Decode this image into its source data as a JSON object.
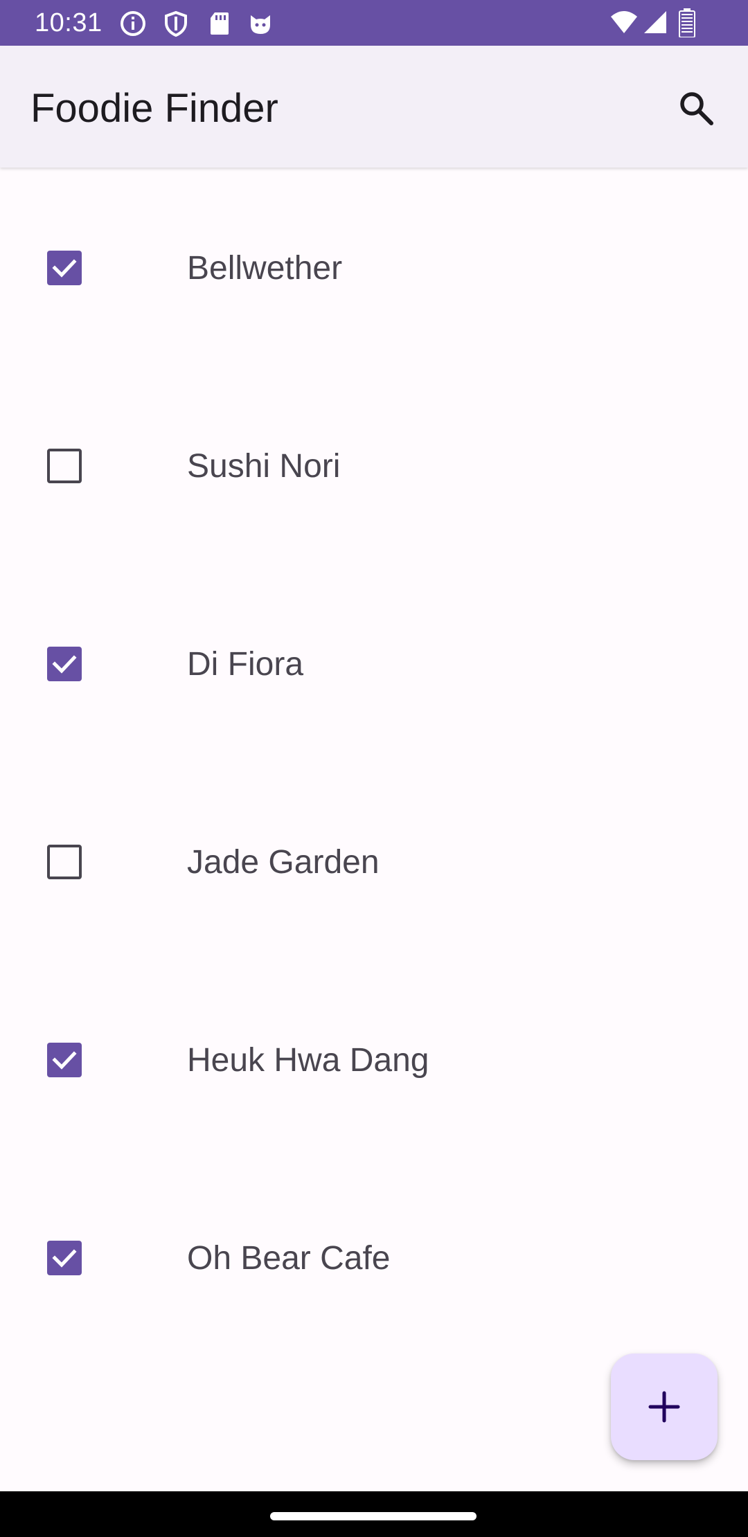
{
  "status_bar": {
    "time": "10:31",
    "left_icons": [
      "info-icon",
      "shield-icon",
      "sd-card-icon",
      "cat-icon"
    ],
    "right_icons": [
      "wifi-icon",
      "cell-signal-icon",
      "battery-icon"
    ],
    "color": "#6750a4"
  },
  "app_bar": {
    "title": "Foodie Finder",
    "action_icon": "search-icon"
  },
  "restaurants": [
    {
      "name": "Bellwether",
      "checked": true
    },
    {
      "name": "Sushi Nori",
      "checked": false
    },
    {
      "name": "Di Fiora",
      "checked": true
    },
    {
      "name": "Jade Garden",
      "checked": false
    },
    {
      "name": "Heuk Hwa Dang",
      "checked": true
    },
    {
      "name": "Oh Bear Cafe",
      "checked": true
    }
  ],
  "fab": {
    "icon": "plus-icon",
    "color": "#e9ddff"
  },
  "colors": {
    "primary": "#6750a4",
    "surface": "#fffbfe",
    "app_bar": "#f3eff7",
    "text": "#49454f"
  }
}
